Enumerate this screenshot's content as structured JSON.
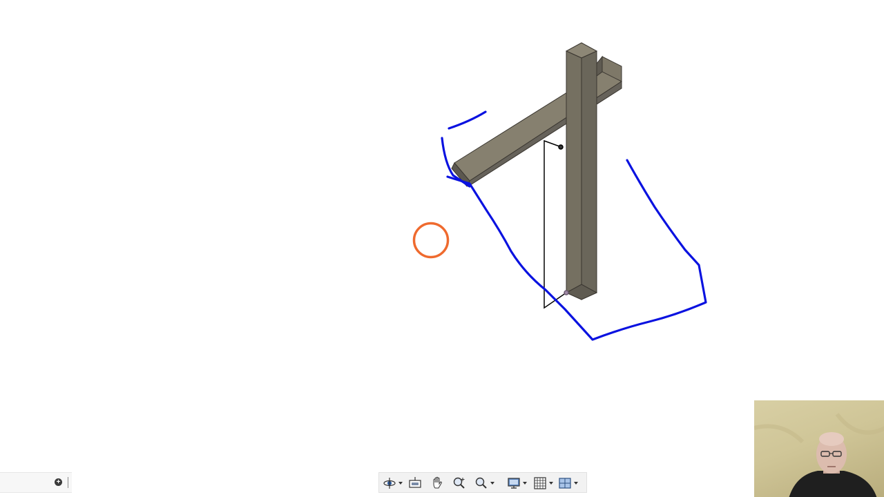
{
  "viewport": {
    "background": "#ffffff",
    "beam_color": "#716c61",
    "annotation_color": "#0a12e0",
    "pointer_color": "#ef6a2e",
    "sketch_color": "#000000"
  },
  "browser_strip": {
    "icons": [
      "add-circle-icon",
      "separator"
    ]
  },
  "nav_toolbar": {
    "tools": [
      {
        "icon": "orbit-icon",
        "has_dropdown": true
      },
      {
        "icon": "look-at-icon",
        "has_dropdown": false
      },
      {
        "icon": "pan-hand-icon",
        "has_dropdown": false
      },
      {
        "icon": "zoom-icon",
        "has_dropdown": false
      },
      {
        "icon": "zoom-window-icon",
        "has_dropdown": true
      },
      {
        "icon": "display-settings-icon",
        "has_dropdown": true
      },
      {
        "icon": "grid-icon",
        "has_dropdown": true
      },
      {
        "icon": "viewports-icon",
        "has_dropdown": true
      }
    ]
  },
  "webcam": {
    "description_icon": "presenter-video-icon"
  }
}
